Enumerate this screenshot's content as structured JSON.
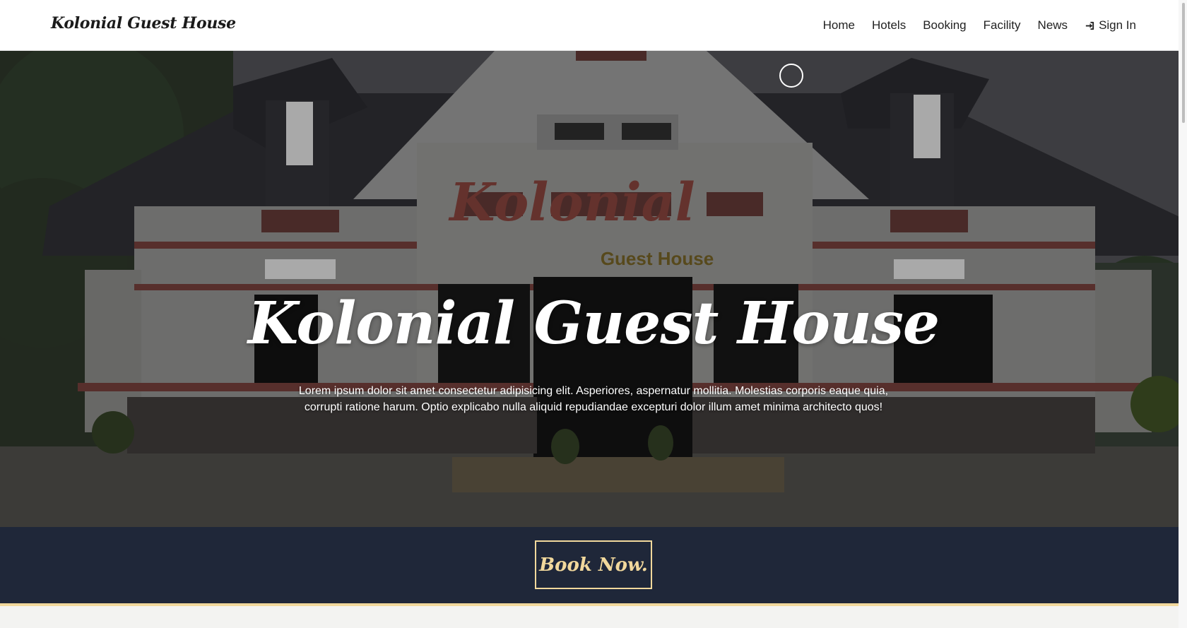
{
  "brand": "Kolonial Guest House",
  "nav": {
    "home": "Home",
    "hotels": "Hotels",
    "booking": "Booking",
    "facility": "Facility",
    "news": "News",
    "signin": "Sign In"
  },
  "hero": {
    "sign_text": "Kolonial",
    "sign_subtext": "Guest House",
    "title": "Kolonial Guest House",
    "description": "Lorem ipsum dolor sit amet consectetur adipisicing elit. Asperiores, aspernatur mollitia. Molestias corporis eaque quia, corrupti ratione harum. Optio explicabo nulla aliquid repudiandae excepturi dolor illum amet minima architecto quos!"
  },
  "cta": {
    "book_label": "Book Now."
  },
  "colors": {
    "accent": "#f1d89c",
    "band": "#1f2739"
  },
  "icons": {
    "signin": "sign-in-icon"
  }
}
